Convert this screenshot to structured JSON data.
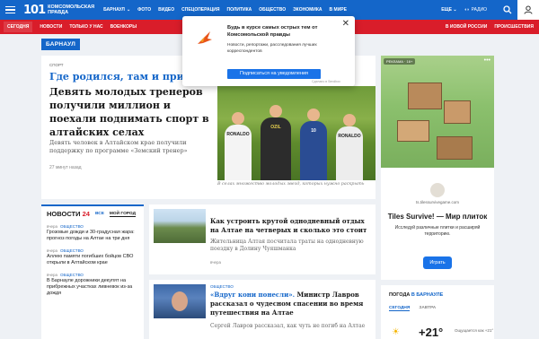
{
  "header": {
    "logo_number": "101",
    "logo_line1": "Комсомольская",
    "logo_line2": "правда",
    "region": "БАРНАУЛ",
    "nav": [
      "ФОТО",
      "ВИДЕО",
      "СПЕЦОПЕРАЦИЯ",
      "ПОЛИТИКА",
      "ОБЩЕСТВО",
      "ЭКОНОМИКА",
      "В МИРЕ"
    ],
    "more": "ЕЩЕ",
    "radio": "РАДИО",
    "search_icon": "search-icon",
    "user_icon": "user-icon"
  },
  "subnav": {
    "items": [
      "СЕГОДНЯ",
      "НОВОСТИ",
      "ТОЛЬКО У НАС",
      "ВОЕНКОРЫ"
    ],
    "right": [
      "В ИОВОЙ РОССИИ",
      "ПРОИСШЕСТВИЯ"
    ]
  },
  "section_badge": "БАРНАУЛ",
  "main_story": {
    "tag": "СПОРТ",
    "title_blue": "Где родился, там и пригоди",
    "title": "Девять молодых тренеров получили миллион и поехали поднимать спорт в алтайских селах",
    "lead": "Девять человек в Алтайском крае получили поддержку по программе «Земский тренер»",
    "time": "27 минут назад",
    "photo_caption": "В селах множество молодых звезд, которых нужно раскрыть",
    "jersey_labels": [
      "RONALDO",
      "OZIL",
      "10",
      "RONALDO"
    ]
  },
  "news": {
    "title": "НОВОСТИ",
    "count": "24",
    "tabs": [
      "ВСЕ",
      "МОЙ ГОРОД"
    ],
    "items": [
      {
        "time": "вчера",
        "tag": "ОБЩЕСТВО",
        "text": "Грозовые дожди и 30-градусная жара: прогноз погоды на Алтае на три дня"
      },
      {
        "time": "вчера",
        "tag": "ОБЩЕСТВО",
        "text": "Аллею памяти погибших бойцов СВО открыли в Алтайском крае"
      },
      {
        "time": "вчера",
        "tag": "ОБЩЕСТВО",
        "text": "В Барнауле дорожники декупят на прибрежных участках ливневок из-за дождя"
      }
    ]
  },
  "mid_stories": [
    {
      "tag": "",
      "title": "Как устроить крутой однодневный отдых на Алтае на четверых и сколько это стоит",
      "lead": "Жительница Алтая посчитала траты на однодневную поездку в Долину Чуяшманка",
      "time": "вчера"
    },
    {
      "tag": "ОБЩЕСТВО",
      "title_blue": "«Вдруг кони понесли».",
      "title": " Министр Лавров рассказал о чудесном спасении во время путешествия на Алтае",
      "lead": "Сергей Лавров рассказал, как чуть не погиб на Алтае",
      "time": ""
    }
  ],
  "ad": {
    "label": "РЕКЛАМА · 16+",
    "domain": "ts.tilessurvivegame.com",
    "title": "Tiles Survive! — Мир плиток",
    "desc": "Исследуй различные плитки и расширяй территорию.",
    "button": "Играть"
  },
  "weather": {
    "title": "ПОГОДА",
    "city": "В БАРНАУЛЕ",
    "tabs": [
      "СЕГОДНЯ",
      "ЗАВТРА"
    ],
    "temp": "+21°",
    "feels": "Ощущается как +21°"
  },
  "popup": {
    "title": "Будь в курсе самых острых тем от Комсомольской правды",
    "desc": "Новости, репортажи, расследования лучших корреспондентов",
    "button": "Подписаться на уведомления",
    "foot": "Сделано в Sendbox"
  },
  "colors": {
    "brand_blue": "#1466c9",
    "brand_red": "#d91d2a",
    "button_blue": "#1a73e8"
  }
}
